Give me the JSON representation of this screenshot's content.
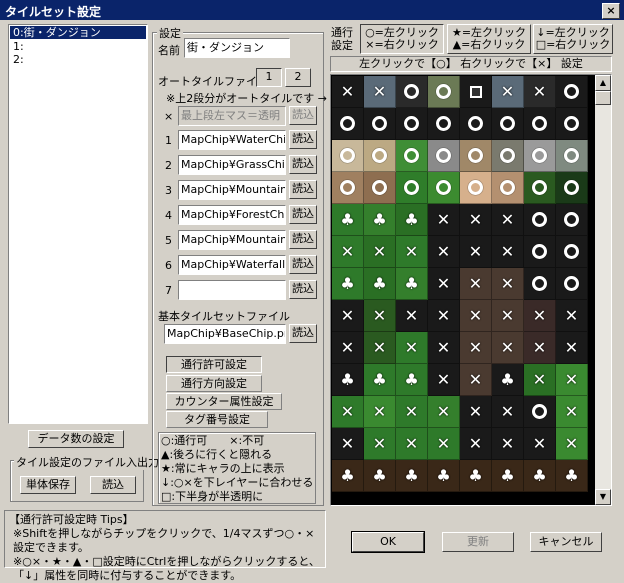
{
  "window": {
    "title": "タイルセット設定",
    "close": "×"
  },
  "tileset_list": [
    "0:街・ダンジョン",
    "1:",
    "2:"
  ],
  "settings": {
    "group_label": "設定",
    "name_label": "名前",
    "name_value": "街・ダンジョン",
    "autotile_label": "オートタイルファイル",
    "page_buttons": [
      "1",
      "2"
    ],
    "note": "※上2段分がオートタイルです →",
    "row0_prefix": "×",
    "row0_placeholder": "最上段左マス＝透明",
    "load_label": "読込",
    "autotiles": [
      {
        "num": "1",
        "file": "MapChip¥WaterChip.p"
      },
      {
        "num": "2",
        "file": "MapChip¥GrassChip.p"
      },
      {
        "num": "3",
        "file": "MapChip¥MountainChi"
      },
      {
        "num": "4",
        "file": "MapChip¥ForestChip.p"
      },
      {
        "num": "5",
        "file": "MapChip¥MountainChi"
      },
      {
        "num": "6",
        "file": "MapChip¥Waterfall_U"
      },
      {
        "num": "7",
        "file": ""
      }
    ],
    "base_label": "基本タイルセットファイル",
    "base_file": "MapChip¥BaseChip.png",
    "mode_buttons": [
      "通行許可設定",
      "通行方向設定",
      "カウンター属性設定",
      "タグ番号設定"
    ]
  },
  "legend": [
    "○:通行可　　×:不可",
    "▲:後ろに行くと隠れる",
    "★:常にキャラの上に表示",
    "↓:○×を下レイヤーに合わせる",
    "□:下半身が半透明に"
  ],
  "data_count_button": "データ数の設定",
  "file_io": {
    "label": "タイル設定のファイル入出力",
    "save": "単体保存",
    "load": "読込"
  },
  "passage": {
    "label_line1": "通行",
    "label_line2": "設定",
    "modes": [
      {
        "line1": "○=左クリック",
        "line2": "×=右クリック"
      },
      {
        "line1": "★=左クリック",
        "line2": "▲=右クリック"
      },
      {
        "line1": "↓=左クリック",
        "line2": "□=右クリック"
      }
    ],
    "hint": "左クリックで【○】 右クリックで【×】 設定"
  },
  "tips": [
    "【通行許可設定時 Tips】",
    "※Shiftを押しながらチップをクリックで、1/4マスずつ○・×設定できます。",
    "※○×・★・▲・□設定時にCtrlを押しながらクリックすると、",
    "「↓」属性を同時に付与することができます。"
  ],
  "dialog_buttons": {
    "ok": "OK",
    "update": "更新",
    "cancel": "キャンセル"
  },
  "grid": {
    "rows": [
      [
        "x",
        "x",
        "o",
        "o",
        "sq",
        "x",
        "x",
        "o"
      ],
      [
        "o",
        "o",
        "o",
        "o",
        "o",
        "o",
        "o",
        "o"
      ],
      [
        "o",
        "o",
        "o",
        "o",
        "o",
        "o",
        "o",
        "o"
      ],
      [
        "o",
        "o",
        "o",
        "o",
        "o",
        "o",
        "o",
        "o"
      ],
      [
        "star",
        "star",
        "star",
        "x",
        "x",
        "x",
        "o",
        "o"
      ],
      [
        "x",
        "x",
        "x",
        "x",
        "x",
        "x",
        "o",
        "o"
      ],
      [
        "star",
        "star",
        "star",
        "x",
        "x",
        "x",
        "o",
        "o"
      ],
      [
        "x",
        "x",
        "x",
        "x",
        "x",
        "x",
        "x",
        "x"
      ],
      [
        "x",
        "x",
        "x",
        "x",
        "x",
        "x",
        "x",
        "x"
      ],
      [
        "star",
        "star",
        "star",
        "x",
        "x",
        "star",
        "x",
        "x"
      ],
      [
        "x",
        "x",
        "x",
        "x",
        "x",
        "x",
        "o",
        "x"
      ],
      [
        "x",
        "x",
        "x",
        "x",
        "x",
        "x",
        "x",
        "x"
      ],
      [
        "star",
        "star",
        "star",
        "star",
        "star",
        "star",
        "star",
        "star"
      ]
    ],
    "colors": [
      [
        "#1a1a1a",
        "#5a6a78",
        "#2a2a2a",
        "#6b7a55",
        "#1a1a1a",
        "#5a6a78",
        "#2a2a2a",
        "#1a1a1a"
      ],
      [
        "#1a1a1a",
        "#1a1a1a",
        "#1a1a1a",
        "#1a1a1a",
        "#1a1a1a",
        "#1a1a1a",
        "#1a1a1a",
        "#1a1a1a"
      ],
      [
        "#c8b89a",
        "#bca983",
        "#3f8e36",
        "#8a8a8a",
        "#a08868",
        "#7a7a6e",
        "#9a9a9a",
        "#7f8a80"
      ],
      [
        "#a08060",
        "#8e6e50",
        "#2f7d2a",
        "#3c8b30",
        "#d6b08c",
        "#b49070",
        "#2a5a20",
        "#1a3a18"
      ],
      [
        "#2e7a2a",
        "#347f2c",
        "#2a6f24",
        "#1a1a1a",
        "#1a1a1a",
        "#1a1a1a",
        "#1a1a1a",
        "#1a1a1a"
      ],
      [
        "#2e7a2a",
        "#2a6f24",
        "#2e7a2a",
        "#1a1a1a",
        "#1a1a1a",
        "#1a1a1a",
        "#1a1a1a",
        "#1a1a1a"
      ],
      [
        "#2e7a2a",
        "#2a6f24",
        "#347f2c",
        "#1a1a1a",
        "#4a3a30",
        "#4a3a30",
        "#1a1a1a",
        "#1a1a1a"
      ],
      [
        "#1a1a1a",
        "#2a5a20",
        "#1a1a1a",
        "#1a1a1a",
        "#4a3a30",
        "#4a3a30",
        "#3a2a28",
        "#1a1a1a"
      ],
      [
        "#1a1a1a",
        "#2a5a20",
        "#2e7a2a",
        "#1a1a1a",
        "#4a3a30",
        "#4a3a30",
        "#3a2a28",
        "#1a1a1a"
      ],
      [
        "#1a1a1a",
        "#2e7a2a",
        "#2e7a2a",
        "#1a1a1a",
        "#4a3a30",
        "#1a1a1a",
        "#2a6f24",
        "#3a8a30"
      ],
      [
        "#2e7a2a",
        "#3a8a30",
        "#2e7a2a",
        "#347f2c",
        "#1a1a1a",
        "#1a1a1a",
        "#1a1a1a",
        "#3a8a30"
      ],
      [
        "#1a1a1a",
        "#2e7a2a",
        "#2e7a2a",
        "#2e7a2a",
        "#1a1a1a",
        "#1a1a1a",
        "#1a1a1a",
        "#3a8a30"
      ],
      [
        "#3a2818",
        "#3a2818",
        "#3a2818",
        "#3a2818",
        "#3a2818",
        "#3a2818",
        "#3a2818",
        "#3a2818"
      ]
    ]
  }
}
